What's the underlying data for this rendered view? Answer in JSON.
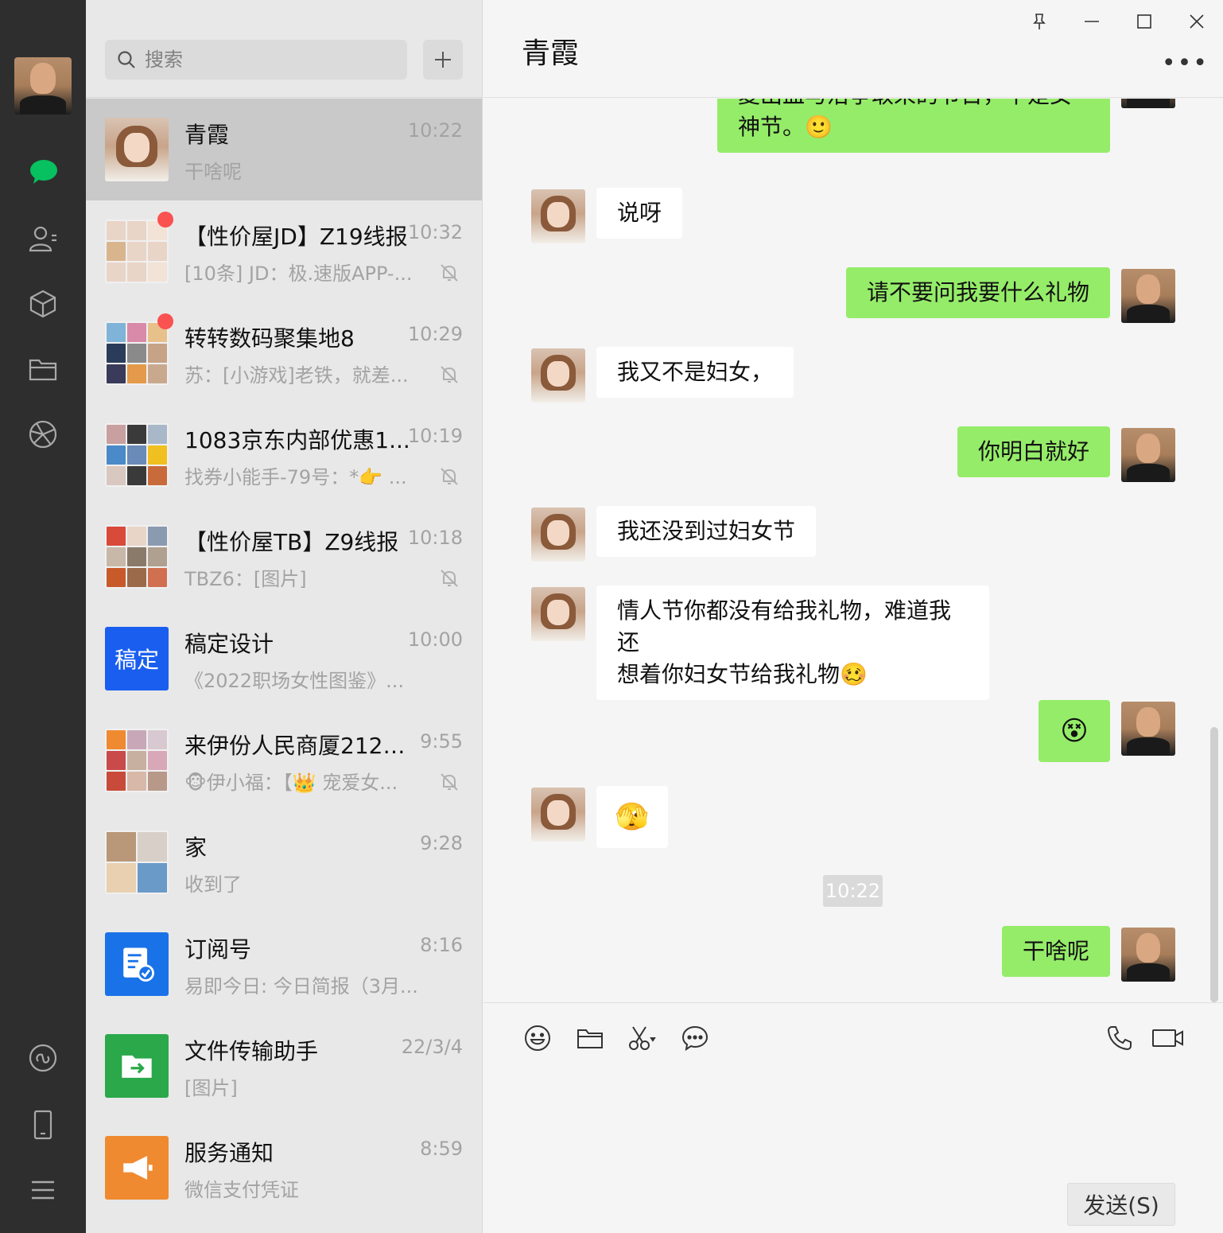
{
  "nav": {
    "icons": [
      "chat-icon",
      "contacts-icon",
      "favorites-icon",
      "files-icon",
      "moments-icon",
      "mini-program-icon",
      "phone-icon",
      "menu-icon"
    ]
  },
  "search": {
    "placeholder": "搜索",
    "add_label": "+"
  },
  "conversations": [
    {
      "name": "青霞",
      "time": "10:22",
      "msg": "干啥呢",
      "active": true
    },
    {
      "name": "【性价屋JD】Z19线报",
      "time": "10:32",
      "msg": "[10条] JD：极.速版APP-...",
      "muted": true,
      "unread": true
    },
    {
      "name": "转转数码聚集地8",
      "time": "10:29",
      "msg": "苏：[小游戏]老铁，就差...",
      "muted": true,
      "unread": true
    },
    {
      "name": "1083京东内部优惠1...",
      "time": "10:19",
      "msg": "找券小能手-79号：*👉 ...",
      "muted": true
    },
    {
      "name": "【性价屋TB】Z9线报",
      "time": "10:18",
      "msg": "TBZ6：[图片]",
      "muted": true
    },
    {
      "name": "稿定设计",
      "time": "10:00",
      "msg": "《2022职场女性图鉴》...",
      "avatar_text": "稿定"
    },
    {
      "name": "来伊份人民商厦2127...",
      "time": "9:55",
      "msg": "🐵伊小福：【👑 宠爱女...",
      "muted": true
    },
    {
      "name": "家",
      "time": "9:28",
      "msg": "收到了"
    },
    {
      "name": "订阅号",
      "time": "8:16",
      "msg": "易即今日: 今日简报（3月..."
    },
    {
      "name": "文件传输助手",
      "time": "22/3/4",
      "msg": "[图片]"
    },
    {
      "name": "服务通知",
      "time": "8:59",
      "msg": "微信支付凭证"
    }
  ],
  "chat": {
    "title": "青霞",
    "more": "•••",
    "messages": [
      {
        "side": "out",
        "text": "夏出血与沿争取来的节日，不是女神节。🙂"
      },
      {
        "side": "in",
        "text": "说呀"
      },
      {
        "side": "out",
        "text": "请不要问我要什么礼物"
      },
      {
        "side": "in",
        "text": "我又不是妇女，"
      },
      {
        "side": "out",
        "text": "你明白就好"
      },
      {
        "side": "in",
        "text": "我还没到过妇女节"
      },
      {
        "side": "in",
        "text_line1": "情人节你都没有给我礼物，难道我还",
        "text_line2": "想着你妇女节给我礼物🥴"
      },
      {
        "side": "out",
        "text": "😵"
      },
      {
        "side": "in",
        "text": "🫣"
      },
      {
        "side": "out",
        "text": "干啥呢"
      }
    ],
    "timestamp": "10:22"
  },
  "input": {
    "send_label": "发送(S)"
  },
  "colors": {
    "out_bubble": "#95ec69",
    "in_bubble": "#ffffff",
    "nav_bg": "#2e2e2e",
    "accent_green": "#07c160"
  }
}
